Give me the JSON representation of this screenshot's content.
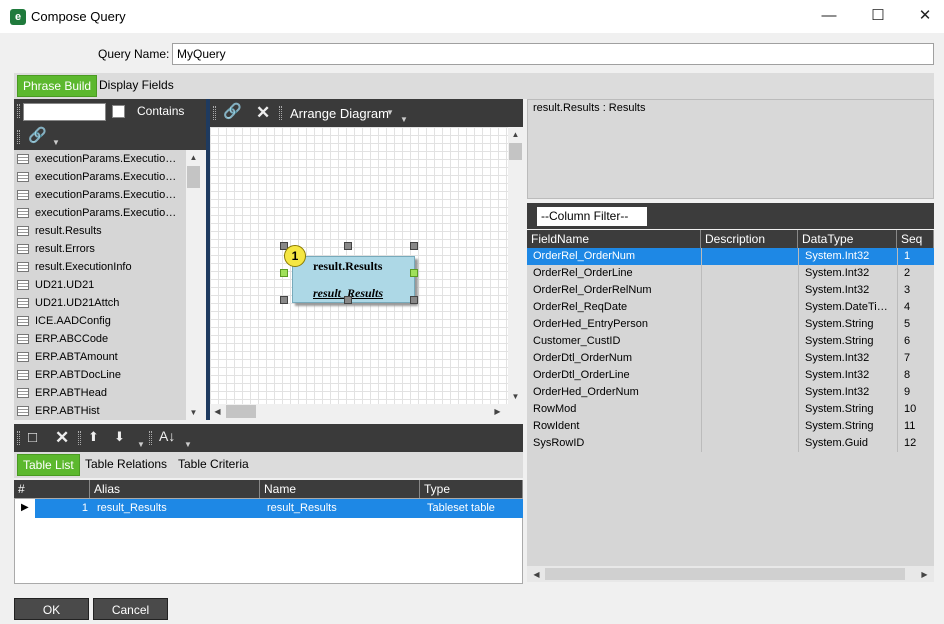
{
  "window": {
    "title": "Compose Query",
    "minimize": "—",
    "maximize": "☐",
    "close": "✕"
  },
  "query_name": {
    "label": "Query Name:",
    "value": "MyQuery"
  },
  "tabs": [
    {
      "label": "Phrase Build",
      "active": true
    },
    {
      "label": "Display Fields",
      "active": false
    }
  ],
  "table_list_panel": {
    "contains_label": "Contains",
    "filter_value": "",
    "items": [
      "executionParams.Executio…",
      "executionParams.Executio…",
      "executionParams.Executio…",
      "executionParams.Executio…",
      "result.Results",
      "result.Errors",
      "result.ExecutionInfo",
      "UD21.UD21",
      "UD21.UD21Attch",
      "ICE.AADConfig",
      "ERP.ABCCode",
      "ERP.ABTAmount",
      "ERP.ABTDocLine",
      "ERP.ABTHead",
      "ERP.ABTHist"
    ]
  },
  "diagram": {
    "arrange_label": "Arrange Diagram",
    "node": {
      "badge": "1",
      "title": "result.Results",
      "alias": "result_Results"
    }
  },
  "bottom_tabs": [
    {
      "label": "Table List",
      "active": true
    },
    {
      "label": "Table Relations",
      "active": false
    },
    {
      "label": "Table Criteria",
      "active": false
    }
  ],
  "table_grid": {
    "columns": [
      "#",
      "Alias",
      "Name",
      "Type"
    ],
    "rows": [
      {
        "num": "1",
        "alias": "result_Results",
        "name": "result_Results",
        "type": "Tableset table"
      }
    ]
  },
  "right_panel": {
    "header_text": "result.Results : Results",
    "column_filter": "--Column Filter--",
    "columns": [
      "FieldName",
      "Description",
      "DataType",
      "Seq"
    ],
    "rows": [
      {
        "field": "OrderRel_OrderNum",
        "desc": "",
        "type": "System.Int32",
        "seq": "1"
      },
      {
        "field": "OrderRel_OrderLine",
        "desc": "",
        "type": "System.Int32",
        "seq": "2"
      },
      {
        "field": "OrderRel_OrderRelNum",
        "desc": "",
        "type": "System.Int32",
        "seq": "3"
      },
      {
        "field": "OrderRel_ReqDate",
        "desc": "",
        "type": "System.DateTi…",
        "seq": "4"
      },
      {
        "field": "OrderHed_EntryPerson",
        "desc": "",
        "type": "System.String",
        "seq": "5"
      },
      {
        "field": "Customer_CustID",
        "desc": "",
        "type": "System.String",
        "seq": "6"
      },
      {
        "field": "OrderDtl_OrderNum",
        "desc": "",
        "type": "System.Int32",
        "seq": "7"
      },
      {
        "field": "OrderDtl_OrderLine",
        "desc": "",
        "type": "System.Int32",
        "seq": "8"
      },
      {
        "field": "OrderHed_OrderNum",
        "desc": "",
        "type": "System.Int32",
        "seq": "9"
      },
      {
        "field": "RowMod",
        "desc": "",
        "type": "System.String",
        "seq": "10"
      },
      {
        "field": "RowIdent",
        "desc": "",
        "type": "System.String",
        "seq": "11"
      },
      {
        "field": "SysRowID",
        "desc": "",
        "type": "System.Guid",
        "seq": "12"
      }
    ]
  },
  "footer": {
    "ok": "OK",
    "cancel": "Cancel"
  }
}
